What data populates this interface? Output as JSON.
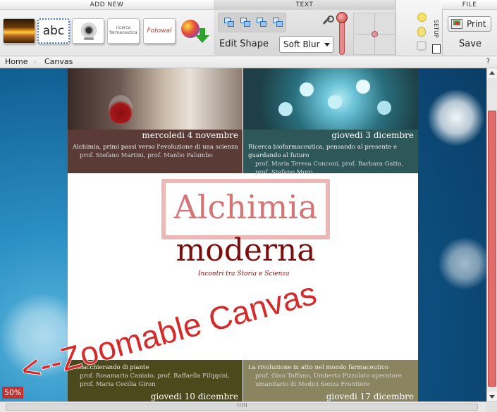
{
  "toolbar": {
    "add_new": {
      "title": "ADD NEW",
      "items": [
        {
          "icon": "image-icon"
        },
        {
          "icon": "text-icon",
          "label": "abc"
        },
        {
          "icon": "webcam-icon"
        },
        {
          "icon": "document-icon",
          "label": "ricerca farmaceutica"
        },
        {
          "icon": "fotowall-icon",
          "label": "Fotowal"
        },
        {
          "icon": "download-icon"
        }
      ]
    },
    "text": {
      "title": "TEXT",
      "edit_shape_label": "Edit Shape",
      "blur_value": "Soft Blur"
    },
    "setup": {
      "title": "SETUP"
    },
    "file": {
      "title": "FILE",
      "print_label": "Print",
      "save_label": "Save"
    }
  },
  "breadcrumb": {
    "home": "Home",
    "current": "Canvas",
    "help": "?"
  },
  "canvas": {
    "zoom": "50%",
    "annotation_text": "Zoomable Canvas",
    "annotation_arrow": "<--",
    "colors": {
      "annotation": "#d42a2a",
      "scrollbar_thumb": "#e06c6c"
    },
    "poster": {
      "title": "Alchimia",
      "subtitle_main": "moderna",
      "tagline": "Incontri tra Storia e Scienza",
      "events": [
        {
          "date": "mercoledi 4 novembre",
          "title": "Alchimia, primi passi verso l'evoluzione di una scienza",
          "authors": "prof. Stefano Martini, prof. Manlio Palumbo"
        },
        {
          "date": "giovedi 3 dicembre",
          "title": "Ricerca biofarmaceutica, pensando al presente e guardando al futuro",
          "authors": "prof. Maria Teresa Conconi, prof. Barbara Gatto, prof. Stefano Moro"
        },
        {
          "date": "giovedi 10 dicembre",
          "title": "Chiacchierando di piante",
          "authors": "prof. Rosamaria Caniato, prof. Raffaella Filippini, prof. Maria Cecilia Giron"
        },
        {
          "date": "giovedi 17 dicembre",
          "title": "La rivoluzione in atto nel mondo farmaceutico",
          "authors": "prof. Gino Toffano, Umberto Pizzolato operatore umanitario di Medici Senza Frontiere"
        }
      ]
    }
  }
}
